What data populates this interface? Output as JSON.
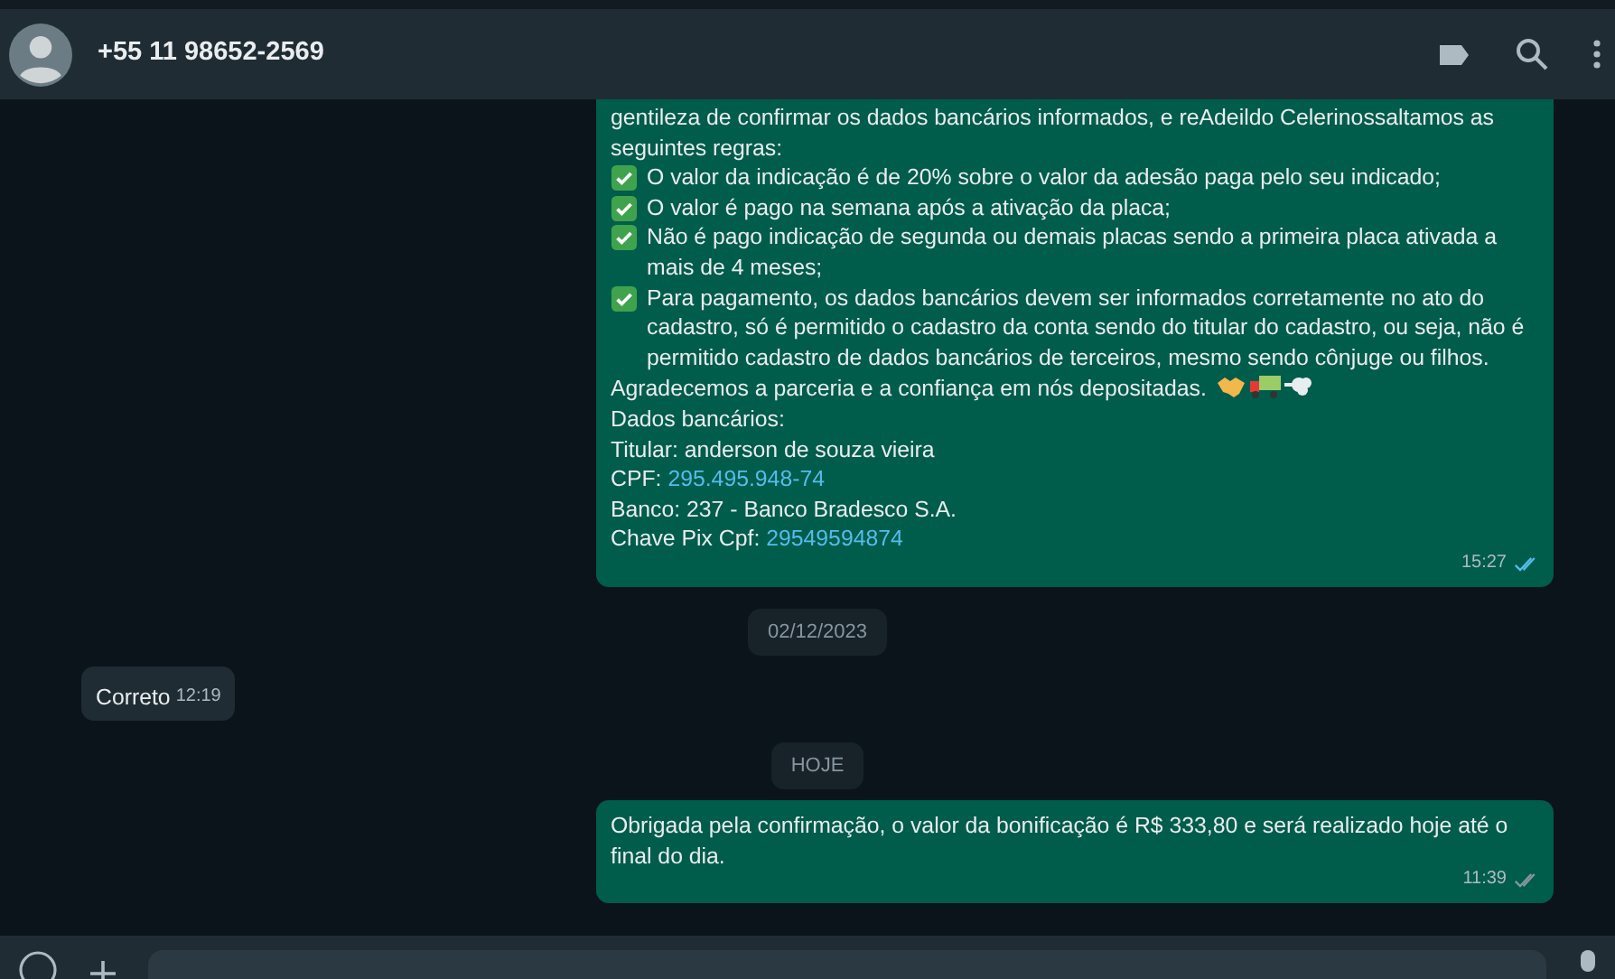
{
  "header": {
    "contact": "+55 11 98652-2569"
  },
  "messages": [
    {
      "kind": "bubble",
      "outgoing": true,
      "time": "15:27",
      "read": true,
      "cut_top": true,
      "paragraphs": [
        {
          "kind": "text",
          "text": "gentileza de confirmar os dados bancários informados, e reAdeildo Celerinossaltamos as seguintes regras:"
        },
        {
          "kind": "check",
          "text": "O valor da indicação é de 20% sobre o valor da adesão paga pelo seu indicado;"
        },
        {
          "kind": "check",
          "text": "O valor é pago na semana após a ativação da placa;"
        },
        {
          "kind": "check",
          "text": "Não é pago indicação de segunda ou demais placas sendo a primeira placa ativada a mais de 4 meses;"
        },
        {
          "kind": "check",
          "text": "Para pagamento, os dados bancários devem ser informados corretamente no ato do cadastro, só é permitido o cadastro da conta sendo do titular do cadastro, ou seja, não é permitido cadastro de dados bancários de terceiros, mesmo sendo cônjuge ou filhos."
        },
        {
          "kind": "emoji",
          "text": "Agradecemos a parceria e a confiança em nós depositadas."
        },
        {
          "kind": "text",
          "text": "Dados bancários:"
        },
        {
          "kind": "text",
          "text": "Titular: anderson de souza vieira"
        },
        {
          "kind": "link",
          "text": "CPF:",
          "link": "295.495.948-74"
        },
        {
          "kind": "text",
          "text": "Banco: 237 - Banco Bradesco S.A."
        },
        {
          "kind": "link",
          "text": "Chave Pix Cpf:",
          "link": "29549594874"
        }
      ]
    },
    {
      "kind": "date",
      "text": "02/12/2023"
    },
    {
      "kind": "bubble",
      "outgoing": false,
      "time": "12:19",
      "cut_top": false,
      "paragraphs": [
        {
          "kind": "text",
          "text": "Correto"
        }
      ]
    },
    {
      "kind": "date",
      "text": "HOJE"
    },
    {
      "kind": "bubble",
      "outgoing": true,
      "time": "11:39",
      "read": false,
      "cut_top": false,
      "paragraphs": [
        {
          "kind": "text",
          "text": "Obrigada pela confirmação, o valor da bonificação é R$ 333,80 e será realizado hoje até o final do dia."
        }
      ]
    }
  ]
}
